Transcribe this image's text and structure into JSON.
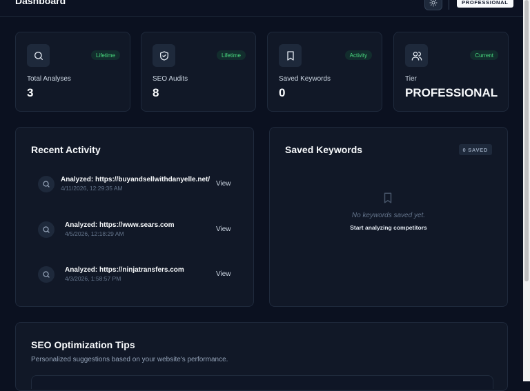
{
  "header": {
    "title": "Dashboard",
    "theme_icon": "sun-icon",
    "tier_chip": "PROFESSIONAL"
  },
  "stats": [
    {
      "icon": "search-icon",
      "badge": "Lifetime",
      "label": "Total Analyses",
      "value": "3"
    },
    {
      "icon": "shield-icon",
      "badge": "Lifetime",
      "label": "SEO Audits",
      "value": "8"
    },
    {
      "icon": "bookmark-icon",
      "badge": "Activity",
      "label": "Saved Keywords",
      "value": "0"
    },
    {
      "icon": "users-icon",
      "badge": "Current",
      "label": "Tier",
      "value": "PROFESSIONAL"
    }
  ],
  "recent_activity": {
    "title": "Recent Activity",
    "items": [
      {
        "title": "Analyzed: https://buyandsellwithdanyelle.net/",
        "time": "4/11/2026, 12:29:35 AM",
        "action": "View"
      },
      {
        "title": "Analyzed: https://www.sears.com",
        "time": "4/5/2026, 12:18:29 AM",
        "action": "View"
      },
      {
        "title": "Analyzed: https://ninjatransfers.com",
        "time": "4/3/2026, 1:58:57 PM",
        "action": "View"
      }
    ]
  },
  "saved_keywords": {
    "title": "Saved Keywords",
    "count_chip": "0 SAVED",
    "empty_text": "No keywords saved yet.",
    "empty_cta": "Start analyzing competitors"
  },
  "tips": {
    "title": "SEO Optimization Tips",
    "subtitle": "Personalized suggestions based on your website's performance."
  },
  "colors": {
    "background": "#0b1120",
    "card": "#111827",
    "badge_green": "#4ade80"
  }
}
